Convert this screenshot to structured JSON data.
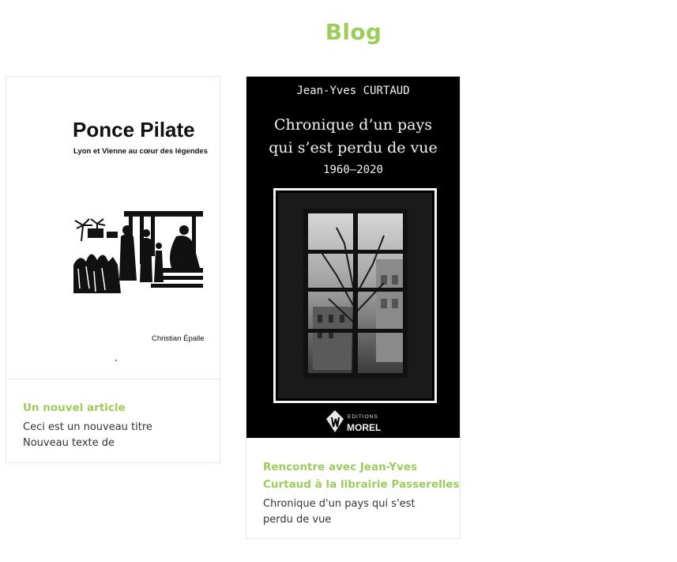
{
  "theme": {
    "accent": "#9ccc5a"
  },
  "page": {
    "title": "Blog"
  },
  "posts": [
    {
      "title": "Un nouvel article",
      "excerpt_lines": [
        "Ceci est un nouveau titre",
        "Nouveau texte de"
      ],
      "cover": {
        "title": "Ponce Pilate",
        "subtitle": "Lyon et Vienne au cœur des légendes",
        "author": "Christian Épalle"
      }
    },
    {
      "title_lines": [
        "Rencontre avec Jean-Yves",
        "Curtaud à la librairie Passerelles"
      ],
      "excerpt_lines": [
        "Chronique d'un pays qui s'est",
        "perdu de vue"
      ],
      "cover": {
        "author": "Jean-Yves CURTAUD",
        "title_lines": [
          "Chronique d’un pays",
          "qui s’est perdu de vue"
        ],
        "years": "1960–2020",
        "publisher_small": "EDITIONS",
        "publisher_name": "MOREL"
      }
    }
  ]
}
